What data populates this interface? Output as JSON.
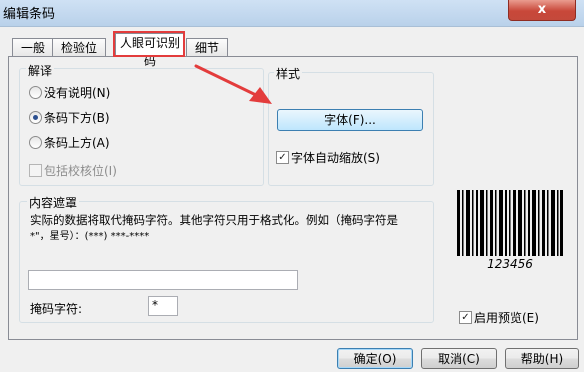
{
  "window": {
    "title": "编辑条码",
    "close_label": "x"
  },
  "tabs": [
    {
      "label": "一般",
      "active": false
    },
    {
      "label": "检验位",
      "active": false
    },
    {
      "label": "人眼可识别码",
      "active": true
    },
    {
      "label": "细节",
      "active": false
    }
  ],
  "annotation": {
    "color": "#e33c3c",
    "highlighted_tab": "人眼可识别码"
  },
  "interpretation": {
    "title": "解译",
    "options": [
      {
        "label": "没有说明(N)",
        "checked": false
      },
      {
        "label": "条码下方(B)",
        "checked": true
      },
      {
        "label": "条码上方(A)",
        "checked": false
      }
    ],
    "include_check_digit": {
      "label": "包括校核位(I)",
      "checked": false,
      "disabled": true
    }
  },
  "style": {
    "title": "样式",
    "font_button": "字体(F)...",
    "auto_shrink": {
      "label": "字体自动缩放(S)",
      "checked": true
    }
  },
  "mask": {
    "title": "内容遮罩",
    "description_line1": "实际的数据将取代掩码字符。其他字符只用于格式化。例如（掩码字符是",
    "description_line2": "*\"，星号）：(***) ***-****",
    "mask_input_value": "",
    "mask_char_label": "掩码字符:",
    "mask_char_value": "*"
  },
  "preview": {
    "barcode_text": "123456",
    "enable_preview": {
      "label": "启用预览(E)",
      "checked": true
    }
  },
  "buttons": {
    "ok": "确定(O)",
    "cancel": "取消(C)",
    "help": "帮助(H)"
  }
}
